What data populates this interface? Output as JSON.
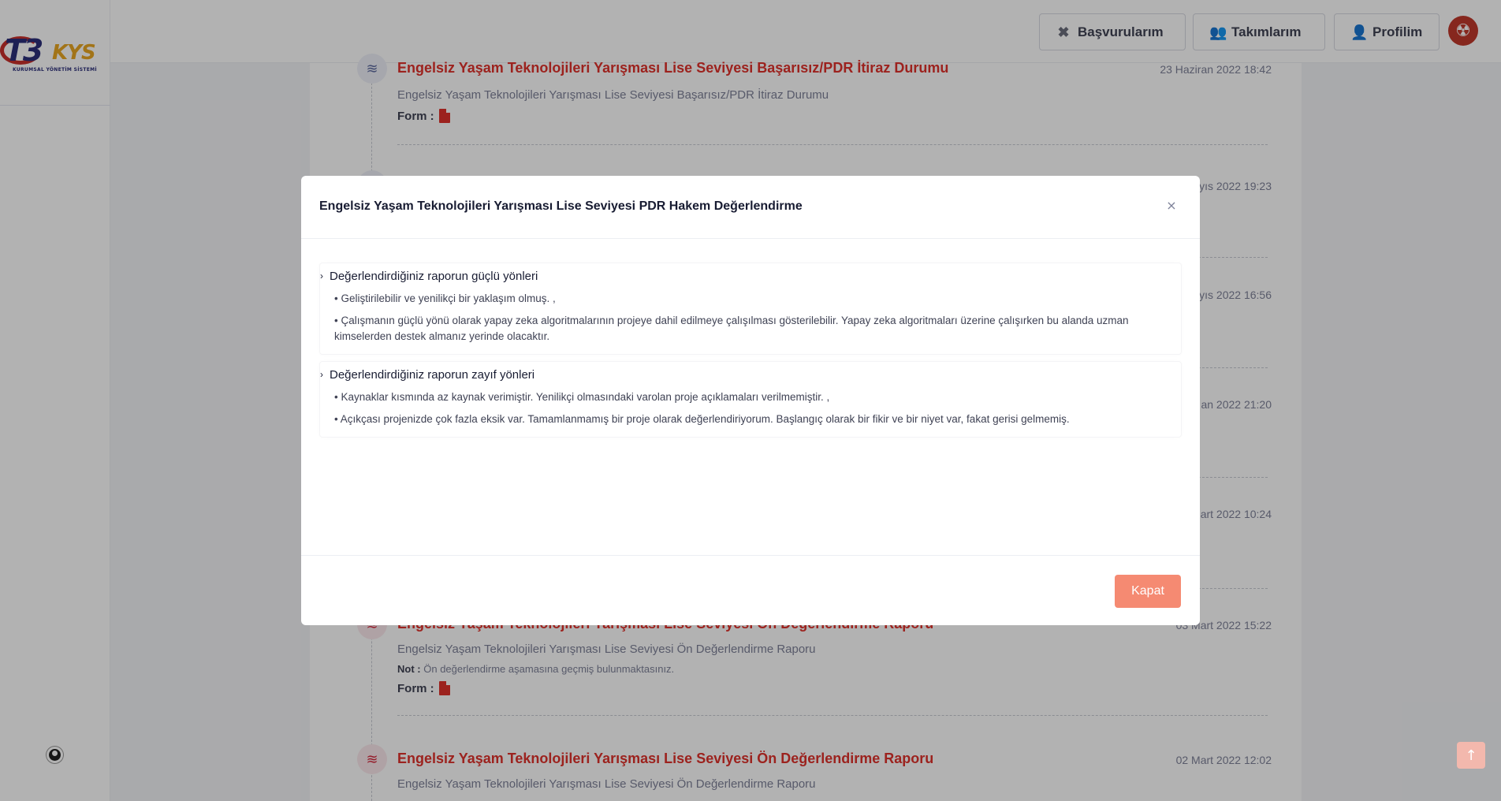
{
  "brand": {
    "logo_main": "T3",
    "logo_kys": "KYS",
    "logo_sub": "KURUMSAL YÖNETİM SİSTEMİ"
  },
  "header": {
    "basvurularim": "Başvurularım",
    "takimlarim": "Takımlarım",
    "profilim": "Profilim"
  },
  "timeline": [
    {
      "title": "Engelsiz Yaşam Teknolojileri Yarışması Lise Seviyesi Başarısız/PDR İtiraz Durumu",
      "date": "23 Haziran 2022 18:42",
      "desc": "Engelsiz Yaşam Teknolojileri Yarışması Lise Seviyesi Başarısız/PDR İtiraz Durumu",
      "form_label": "Form :"
    },
    {
      "date": "yıs 2022 19:23"
    },
    {
      "date": "yıs 2022 16:56"
    },
    {
      "date": "an 2022 21:20"
    },
    {
      "date": "art 2022 10:24"
    },
    {
      "title": "Engelsiz Yaşam Teknolojileri Yarışması Lise Seviyesi Ön Değerlendirme Raporu",
      "date": "03 Mart 2022 15:22",
      "desc": "Engelsiz Yaşam Teknolojileri Yarışması Lise Seviyesi Ön Değerlendirme Raporu",
      "note_label": "Not :",
      "note": "Ön değerlendirme aşamasına geçmiş bulunmaktasınız.",
      "form_label": "Form :"
    },
    {
      "title": "Engelsiz Yaşam Teknolojileri Yarışması Lise Seviyesi Ön Değerlendirme Raporu",
      "date": "02 Mart 2022 12:02",
      "desc": "Engelsiz Yaşam Teknolojileri Yarışması Lise Seviyesi Ön Değerlendirme Raporu"
    }
  ],
  "modal": {
    "title": "Engelsiz Yaşam Teknolojileri Yarışması Lise Seviyesi PDR Hakem Değerlendirme",
    "close_symbol": "×",
    "sections": [
      {
        "heading": "Değerlendirdiğiniz raporun güçlü yönleri",
        "items": [
          "• Geliştirilebilir ve yenilikçi bir yaklaşım olmuş. ,",
          "• Çalışmanın güçlü yönü olarak yapay zeka algoritmalarının projeye dahil edilmeye çalışılması gösterilebilir. Yapay zeka algoritmaları üzerine çalışırken bu alanda uzman kimselerden destek almanız yerinde olacaktır."
        ]
      },
      {
        "heading": "Değerlendirdiğiniz raporun zayıf yönleri",
        "items": [
          "• Kaynaklar kısmında az kaynak verimiştir. Yenilikçi olmasındaki varolan proje açıklamaları verilmemiştir. ,",
          "• Açıkçası projenizde çok fazla eksik var. Tamamlanmamış bir proje olarak değerlendiriyorum. Başlangıç olarak bir fikir ve bir niyet var, fakat gerisi gelmemiş."
        ]
      }
    ],
    "close_button": "Kapat"
  },
  "colors": {
    "accent": "#e0322b",
    "kapat_button": "#f58a72",
    "overlay": "rgba(0,0,0,0.3)"
  }
}
